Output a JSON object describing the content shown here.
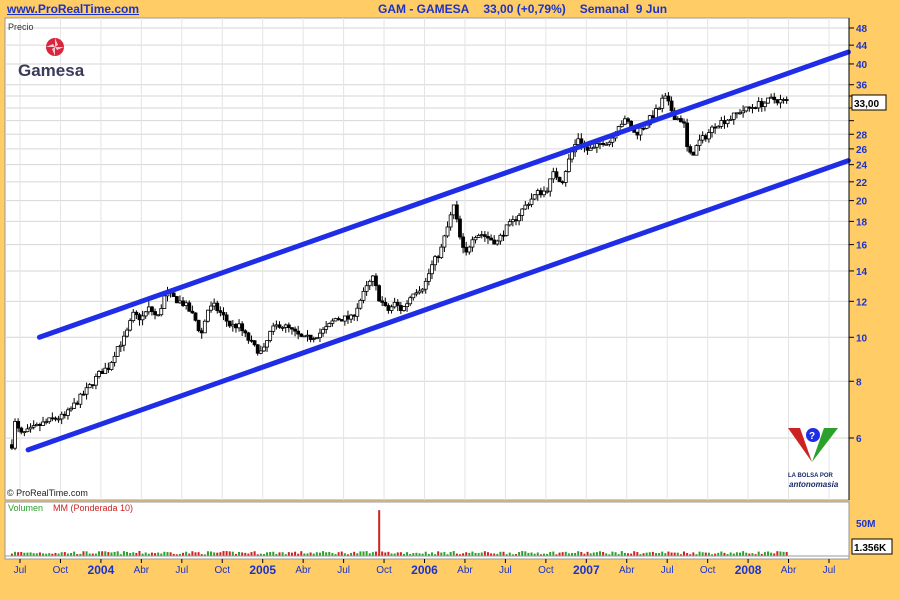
{
  "header": {
    "site": "www.ProRealTime.com",
    "ticker": "GAM - GAMESA",
    "quote": "33,00 (+0,79%)",
    "period": "Semanal  9 Jun"
  },
  "panels": {
    "price_label": "Precio",
    "copyright": "© ProRealTime.com",
    "volume_label_1": "Volumen",
    "volume_label_2": "MM (Ponderada 10)"
  },
  "logo": {
    "brand": "Gamesa"
  },
  "badge": {
    "line1": "LA BOLSA POR",
    "line2": "antonomasia"
  },
  "colors": {
    "background": "#ffcc66",
    "panel": "#ffffff",
    "text_blue": "#1a33cc",
    "channel": "#1f2ee6",
    "candle": "#000000",
    "volume_up": "#2ca02c",
    "volume_down": "#cc2222"
  },
  "chart_data": [
    {
      "type": "line",
      "title": "GAM - GAMESA",
      "y_scale": "log",
      "ylim": [
        5.2,
        50
      ],
      "y_ticks": [
        6,
        8,
        10,
        12,
        14,
        16,
        18,
        20,
        22,
        24,
        26,
        28,
        30,
        32,
        34,
        36,
        40,
        44,
        48
      ],
      "y_tick_labels": [
        "6",
        "8",
        "10",
        "12",
        "14",
        "16",
        "18",
        "20",
        "22",
        "24",
        "26",
        "28",
        "",
        "",
        "",
        "36",
        "40",
        "44",
        "48"
      ],
      "x_range": [
        2003.5,
        2008.62
      ],
      "x_ticks": [
        {
          "x": 2003.5,
          "label": "Jul",
          "year": false
        },
        {
          "x": 2003.75,
          "label": "Oct",
          "year": false
        },
        {
          "x": 2004.0,
          "label": "2004",
          "year": true
        },
        {
          "x": 2004.25,
          "label": "Abr",
          "year": false
        },
        {
          "x": 2004.5,
          "label": "Jul",
          "year": false
        },
        {
          "x": 2004.75,
          "label": "Oct",
          "year": false
        },
        {
          "x": 2005.0,
          "label": "2005",
          "year": true
        },
        {
          "x": 2005.25,
          "label": "Abr",
          "year": false
        },
        {
          "x": 2005.5,
          "label": "Jul",
          "year": false
        },
        {
          "x": 2005.75,
          "label": "Oct",
          "year": false
        },
        {
          "x": 2006.0,
          "label": "2006",
          "year": true
        },
        {
          "x": 2006.25,
          "label": "Abr",
          "year": false
        },
        {
          "x": 2006.5,
          "label": "Jul",
          "year": false
        },
        {
          "x": 2006.75,
          "label": "Oct",
          "year": false
        },
        {
          "x": 2007.0,
          "label": "2007",
          "year": true
        },
        {
          "x": 2007.25,
          "label": "Abr",
          "year": false
        },
        {
          "x": 2007.5,
          "label": "Jul",
          "year": false
        },
        {
          "x": 2007.75,
          "label": "Oct",
          "year": false
        },
        {
          "x": 2008.0,
          "label": "2008",
          "year": true
        },
        {
          "x": 2008.25,
          "label": "Abr",
          "year": false
        },
        {
          "x": 2008.5,
          "label": "Jul",
          "year": false
        }
      ],
      "last_price": 33.0,
      "last_price_label": "33,00",
      "price_path": [
        [
          2003.45,
          5.8
        ],
        [
          2003.47,
          6.5
        ],
        [
          2003.5,
          6.1
        ],
        [
          2003.55,
          6.2
        ],
        [
          2003.62,
          6.4
        ],
        [
          2003.7,
          6.6
        ],
        [
          2003.78,
          6.7
        ],
        [
          2003.85,
          7.2
        ],
        [
          2003.92,
          7.7
        ],
        [
          2004.0,
          8.4
        ],
        [
          2004.05,
          8.6
        ],
        [
          2004.1,
          9.5
        ],
        [
          2004.15,
          10.0
        ],
        [
          2004.2,
          11.2
        ],
        [
          2004.25,
          11.0
        ],
        [
          2004.3,
          11.6
        ],
        [
          2004.35,
          11.0
        ],
        [
          2004.4,
          12.5
        ],
        [
          2004.45,
          12.2
        ],
        [
          2004.52,
          11.8
        ],
        [
          2004.58,
          11.0
        ],
        [
          2004.62,
          10.1
        ],
        [
          2004.66,
          11.5
        ],
        [
          2004.7,
          11.7
        ],
        [
          2004.75,
          11.2
        ],
        [
          2004.8,
          10.6
        ],
        [
          2004.85,
          10.6
        ],
        [
          2004.9,
          10.0
        ],
        [
          2004.95,
          9.5
        ],
        [
          2005.0,
          9.2
        ],
        [
          2005.05,
          10.3
        ],
        [
          2005.1,
          10.7
        ],
        [
          2005.15,
          10.5
        ],
        [
          2005.2,
          10.2
        ],
        [
          2005.25,
          9.9
        ],
        [
          2005.3,
          10.0
        ],
        [
          2005.35,
          10.2
        ],
        [
          2005.4,
          10.5
        ],
        [
          2005.45,
          11.0
        ],
        [
          2005.5,
          11.0
        ],
        [
          2005.55,
          11.0
        ],
        [
          2005.6,
          12.0
        ],
        [
          2005.65,
          13.0
        ],
        [
          2005.68,
          13.5
        ],
        [
          2005.72,
          12.2
        ],
        [
          2005.77,
          11.4
        ],
        [
          2005.82,
          11.9
        ],
        [
          2005.85,
          11.5
        ],
        [
          2005.88,
          11.7
        ],
        [
          2005.93,
          12.6
        ],
        [
          2006.0,
          13.0
        ],
        [
          2006.05,
          14.5
        ],
        [
          2006.1,
          15.5
        ],
        [
          2006.15,
          17.8
        ],
        [
          2006.18,
          19.5
        ],
        [
          2006.22,
          16.5
        ],
        [
          2006.25,
          15.0
        ],
        [
          2006.3,
          16.8
        ],
        [
          2006.35,
          16.9
        ],
        [
          2006.4,
          16.5
        ],
        [
          2006.45,
          16.2
        ],
        [
          2006.5,
          17.3
        ],
        [
          2006.55,
          18.0
        ],
        [
          2006.6,
          19.0
        ],
        [
          2006.65,
          20.0
        ],
        [
          2006.7,
          20.8
        ],
        [
          2006.75,
          21.0
        ],
        [
          2006.8,
          23.0
        ],
        [
          2006.85,
          22.0
        ],
        [
          2006.9,
          25.0
        ],
        [
          2006.95,
          27.5
        ],
        [
          2007.0,
          25.8
        ],
        [
          2007.05,
          26.0
        ],
        [
          2007.1,
          27.0
        ],
        [
          2007.15,
          27.0
        ],
        [
          2007.2,
          29.5
        ],
        [
          2007.25,
          30.0
        ],
        [
          2007.3,
          28.0
        ],
        [
          2007.35,
          29.0
        ],
        [
          2007.4,
          30.5
        ],
        [
          2007.45,
          32.0
        ],
        [
          2007.48,
          34.0
        ],
        [
          2007.52,
          32.0
        ],
        [
          2007.55,
          30.5
        ],
        [
          2007.6,
          30.0
        ],
        [
          2007.63,
          25.0
        ],
        [
          2007.66,
          25.5
        ],
        [
          2007.7,
          27.0
        ],
        [
          2007.75,
          28.0
        ],
        [
          2007.8,
          29.5
        ],
        [
          2007.85,
          30.0
        ],
        [
          2007.9,
          30.5
        ],
        [
          2007.95,
          31.5
        ],
        [
          2008.0,
          31.8
        ],
        [
          2008.05,
          32.5
        ],
        [
          2008.1,
          32.8
        ],
        [
          2008.15,
          33.5
        ],
        [
          2008.2,
          33.2
        ],
        [
          2008.25,
          33.0
        ]
      ],
      "channel": [
        {
          "name": "upper",
          "x": [
            2003.62,
            2008.62
          ],
          "y": [
            10.0,
            42.5
          ]
        },
        {
          "name": "lower",
          "x": [
            2003.55,
            2008.62
          ],
          "y": [
            5.65,
            24.5
          ]
        }
      ]
    },
    {
      "type": "bar",
      "y_ticks_labels": [
        "50M"
      ],
      "ylim": [
        0,
        60
      ],
      "last_volume_label": "1.356K",
      "spike": {
        "x": 2005.72,
        "value": 55
      },
      "typical_range": [
        2,
        6
      ]
    }
  ]
}
